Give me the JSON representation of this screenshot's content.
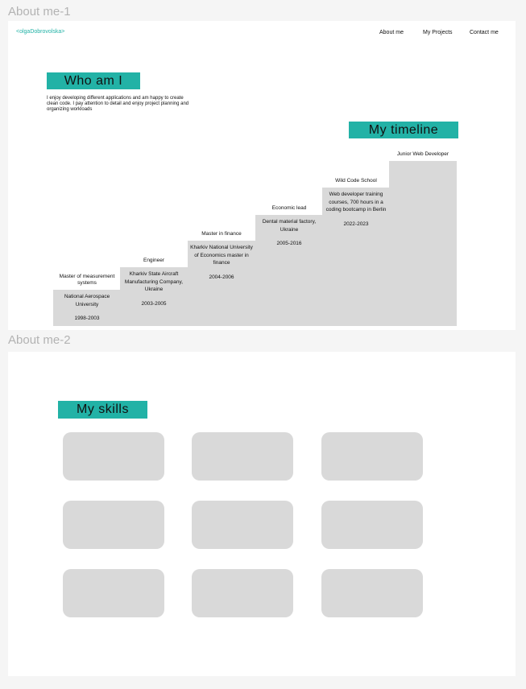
{
  "frames": {
    "frame1": "About me-1",
    "frame2": "About me-2"
  },
  "logo": "<olgaDobrovolska>",
  "nav": [
    "About me",
    "My Projects",
    "Contact me"
  ],
  "who": {
    "title": "Who am I",
    "text": "I enjoy developing different applications and am happy to create clean code. I pay attention to detail and enjoy project planning and organizing workloads"
  },
  "timeline": {
    "title": "My timeline",
    "steps": [
      {
        "title": "Master of measurement systems",
        "place": "National Aerospace University",
        "years": "1998-2003"
      },
      {
        "title": "Engineer",
        "place": "Kharkiv State Aircraft Manufacturing Company, Ukraine",
        "years": "2003-2005"
      },
      {
        "title": "Master in finance",
        "place": "Kharkiv National University of Economics master in finance",
        "years": "2004-2006"
      },
      {
        "title": "Economic lead",
        "place": "Dental material factory, Ukraine",
        "years": "2005-2016"
      },
      {
        "title": "Wild Code School",
        "place": "Web developer training courses, 700 hours in a coding bootcamp in Berlin",
        "years": "2022-2023"
      },
      {
        "title": "Junior Web Developer",
        "place": "",
        "years": ""
      }
    ]
  },
  "skills": {
    "title": "My skills",
    "count": 9
  }
}
